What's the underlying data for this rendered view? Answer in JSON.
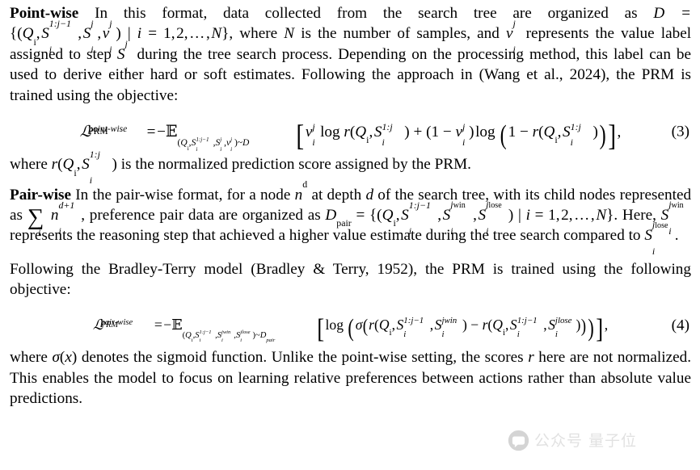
{
  "document": {
    "type": "academic-paper-excerpt",
    "background_color": "#ffffff",
    "text_color": "#000000"
  },
  "sections": {
    "pointwise": {
      "lead": "Point-wise",
      "text_1": "In this format, data collected from the search tree are organized as",
      "math_D_eq": "D =",
      "text_2": ", where",
      "math_N": "N",
      "text_3": "is the number of samples, and",
      "text_4": "represents the value label assigned to step",
      "text_5": "during the tree search process. Depending on the processing method, this label can be used to derive either hard or soft estimates. Following the approach in (Wang et al., 2024), the PRM is trained using the objective:"
    },
    "equation3": {
      "number": "(3)",
      "lhs_symbol": "L",
      "lhs_superscript": "point-wise",
      "lhs_subscript": "PRM",
      "equals": "=",
      "minus": "−",
      "expectation": "E",
      "expectation_subscript_dist": "~D",
      "log": "log",
      "plus": "+",
      "one": "1",
      "comma": ",",
      "r": "r",
      "Q": "Q",
      "S": "S",
      "v": "v",
      "i": "i",
      "j": "j",
      "range_1j": "1:j",
      "range_1jm1": "1:j−1"
    },
    "after_eq3": {
      "text_1": "where",
      "text_2": "is the normalized prediction score assigned by the PRM."
    },
    "pairwise": {
      "lead": "Pair-wise",
      "text_1": "In the pair-wise format, for a node",
      "text_2": "at depth",
      "text_3": "of the search tree, with its child nodes represented as",
      "text_4": ", preference pair data are organized as",
      "text_5": "Here,",
      "text_6": "represents the reasoning step that achieved a higher value estimate during the tree search compared to",
      "text_7": "."
    },
    "bradley_terry": {
      "text": "Following the Bradley-Terry model (Bradley & Terry, 1952), the PRM is trained using the following objective:"
    },
    "equation4": {
      "number": "(4)",
      "lhs_symbol": "L",
      "lhs_superscript": "pair-wise",
      "lhs_subscript": "PRM",
      "equals": "=",
      "minus": "−",
      "expectation": "E",
      "expectation_subscript_dist": "~D",
      "dist_subscript": "pair",
      "log": "log",
      "sigma": "σ",
      "r": "r",
      "jwin": "jwin",
      "jlose": "jlose"
    },
    "after_eq4": {
      "text_1": "where",
      "text_2": "denotes the sigmoid function. Unlike the point-wise setting, the scores",
      "text_3": "here are not normalized. This enables the model to focus on learning relative preferences between actions rather than absolute value predictions."
    }
  },
  "watermark": {
    "text": "公众号 量子位",
    "color": "#b9b9b9",
    "logo_name": "speech-bubble-logo"
  }
}
